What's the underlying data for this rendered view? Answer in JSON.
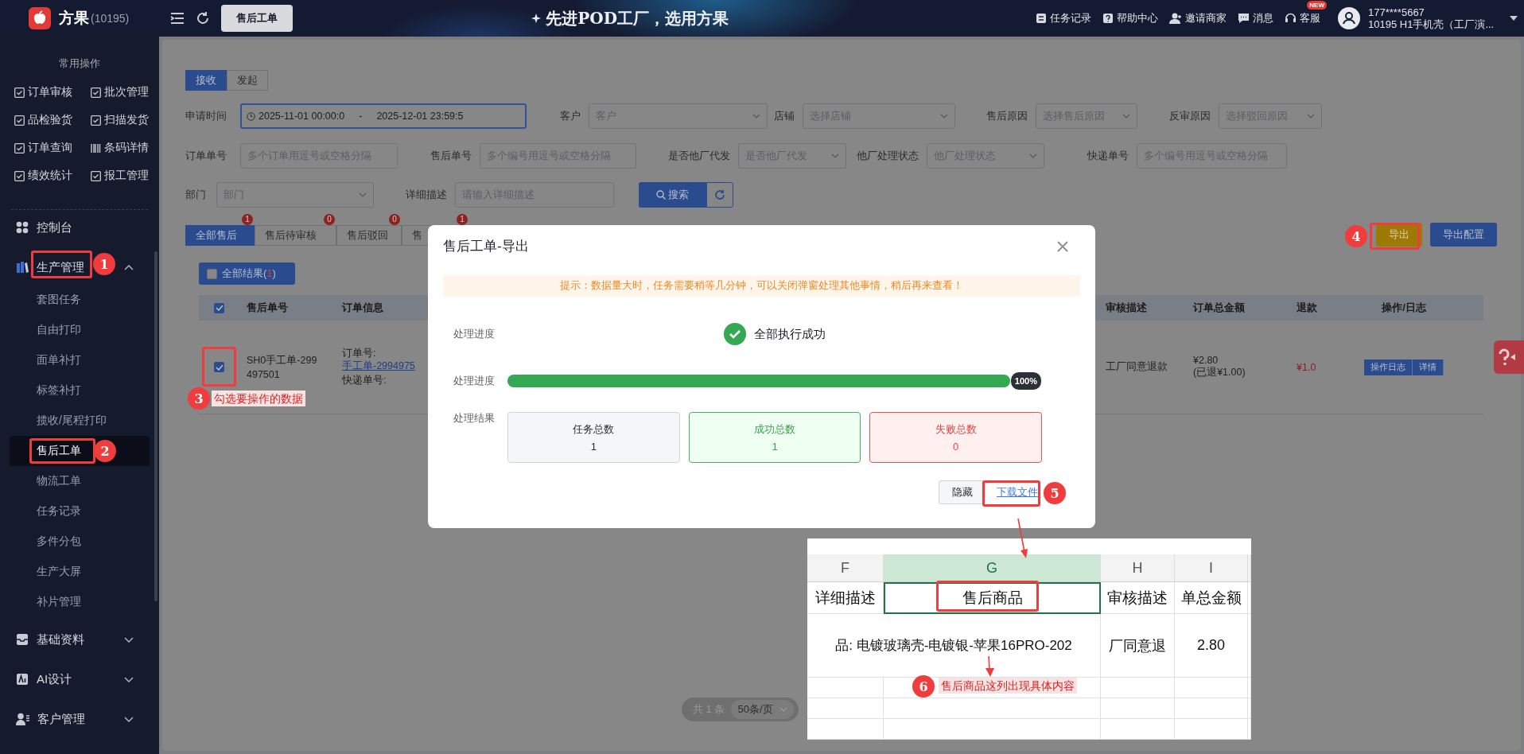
{
  "header": {
    "logo": "方果",
    "account": "(10195)",
    "open_tab": "售后工单",
    "slogan": "先进POD工厂，选用方果",
    "links": [
      {
        "label": "任务记录"
      },
      {
        "label": "帮助中心"
      },
      {
        "label": "邀请商家"
      },
      {
        "label": "消息"
      },
      {
        "label": "客服",
        "badge": "NEW"
      }
    ],
    "user": {
      "phone": "177****5667",
      "store": "10195  H1手机壳（工厂演..."
    }
  },
  "sidebar": {
    "title": "常用操作",
    "shortcuts": [
      "订单审核",
      "批次管理",
      "品检验货",
      "扫描发货",
      "订单查询",
      "条码详情",
      "绩效统计",
      "报工管理"
    ],
    "menu": [
      {
        "label": "控制台",
        "kind": "link"
      },
      {
        "label": "生产管理",
        "kind": "group",
        "expanded": true,
        "children": [
          {
            "label": "套图任务",
            "selected": false
          },
          {
            "label": "自由打印",
            "selected": false
          },
          {
            "label": "面单补打",
            "selected": false
          },
          {
            "label": "标签补打",
            "selected": false
          },
          {
            "label": "揽收/尾程打印",
            "selected": false
          },
          {
            "label": "售后工单",
            "selected": true
          },
          {
            "label": "物流工单",
            "selected": false
          },
          {
            "label": "任务记录",
            "selected": false
          },
          {
            "label": "多件分包",
            "selected": false
          },
          {
            "label": "生产大屏",
            "selected": false
          },
          {
            "label": "补片管理",
            "selected": false
          }
        ]
      },
      {
        "label": "基础资料",
        "kind": "group",
        "expanded": false
      },
      {
        "label": "AI设计",
        "kind": "group",
        "expanded": false
      },
      {
        "label": "客户管理",
        "kind": "group",
        "expanded": false
      }
    ]
  },
  "direction_tabs": [
    {
      "label": "接收",
      "selected": true
    },
    {
      "label": "发起",
      "selected": false
    }
  ],
  "filters": [
    [
      {
        "label": "申请时间",
        "kind": "range",
        "start": "2025-11-01 00:00:0",
        "separator": "-",
        "end": "2025-12-01 23:59:5"
      },
      {
        "label": "客户",
        "kind": "select",
        "placeholder": "客户"
      },
      {
        "label": "店铺",
        "kind": "select",
        "placeholder": "选择店铺"
      },
      {
        "label": "售后原因",
        "kind": "select",
        "placeholder": "选择售后原因"
      },
      {
        "label": "反审原因",
        "kind": "select",
        "placeholder": "选择驳回原因"
      }
    ],
    [
      {
        "label": "订单单号",
        "kind": "input",
        "placeholder": "多个订单用逗号或空格分隔"
      },
      {
        "label": "售后单号",
        "kind": "input",
        "placeholder": "多个编号用逗号或空格分隔"
      },
      {
        "label": "是否他厂代发",
        "kind": "select",
        "placeholder": "是否他厂代发"
      },
      {
        "label": "他厂处理状态",
        "kind": "select",
        "placeholder": "他厂处理状态"
      },
      {
        "label": "快递单号",
        "kind": "input",
        "placeholder": "多个编号用逗号或空格分隔"
      }
    ],
    [
      {
        "label": "部门",
        "kind": "select",
        "placeholder": "部门"
      },
      {
        "label": "详细描述",
        "kind": "input",
        "placeholder": "请输入详细描述"
      }
    ]
  ],
  "search_button": "搜索",
  "status_tabs": [
    {
      "label": "全部售后",
      "badge": "1",
      "selected": true
    },
    {
      "label": "售后待审核",
      "badge": "0",
      "selected": false
    },
    {
      "label": "售后驳回",
      "badge": "0",
      "selected": false
    },
    {
      "label": "售",
      "badge": "1",
      "selected": false
    }
  ],
  "export_buttons": [
    {
      "label": "导出",
      "highlighted": true
    },
    {
      "label": "导出配置",
      "highlighted": false
    }
  ],
  "select_all": {
    "label": "全部结果(",
    "count": "1",
    "close": ")",
    "checked": false
  },
  "table": {
    "columns": [
      "售后单号",
      "订单信息",
      "审核描述",
      "订单总金额",
      "退款",
      "操作/日志"
    ],
    "header_checked": true,
    "rows": [
      {
        "checked": true,
        "aftersale_no": "SH0手工单-299497501",
        "order_label": "订单号: ",
        "order_link": "手工单-2994975",
        "express_label": "快递单号:",
        "audit": "工厂同意退款",
        "amount": "¥2.80",
        "refunded": "(已退¥1.00)",
        "refund": "¥1.0",
        "actions": [
          "操作日志",
          "详情"
        ]
      }
    ]
  },
  "pagination": {
    "total": "共 1 条",
    "page_size": "50条/页"
  },
  "modal": {
    "title": "售后工单-导出",
    "notice": "提示：数据量大时，任务需要稍等几分钟，可以关闭弹窗处理其他事情，稍后再来查看！",
    "status_label": "处理进度",
    "status": "全部执行成功",
    "progress_label": "处理进度",
    "progress": {
      "level": 1,
      "reading": "100%"
    },
    "result_label": "处理结果",
    "results": [
      {
        "label": "任务总数",
        "value": "1",
        "kind": "total"
      },
      {
        "label": "成功总数",
        "value": "1",
        "kind": "success"
      },
      {
        "label": "失败总数",
        "value": "0",
        "kind": "failure"
      }
    ],
    "buttons": [
      {
        "label": "隐藏",
        "kind": "button"
      },
      {
        "label": "下载文件",
        "kind": "link"
      }
    ]
  },
  "spreadsheet": {
    "columns": [
      {
        "label": "F",
        "selected": false
      },
      {
        "label": "G",
        "selected": true
      },
      {
        "label": "H",
        "selected": false
      },
      {
        "label": "I",
        "selected": false
      }
    ],
    "header_row": [
      "详细描述",
      "售后商品",
      "审核描述",
      "单总金额"
    ],
    "data_row": {
      "product": "品: 电镀玻璃壳-电镀银-苹果16PRO-202",
      "audit": "厂同意退",
      "amount": "2.80"
    }
  },
  "callouts": [
    {
      "number": "1"
    },
    {
      "number": "2"
    },
    {
      "number": "3",
      "note": "勾选要操作的数据"
    },
    {
      "number": "4"
    },
    {
      "number": "5"
    },
    {
      "number": "6",
      "note": "售后商品这列出现具体内容"
    }
  ]
}
